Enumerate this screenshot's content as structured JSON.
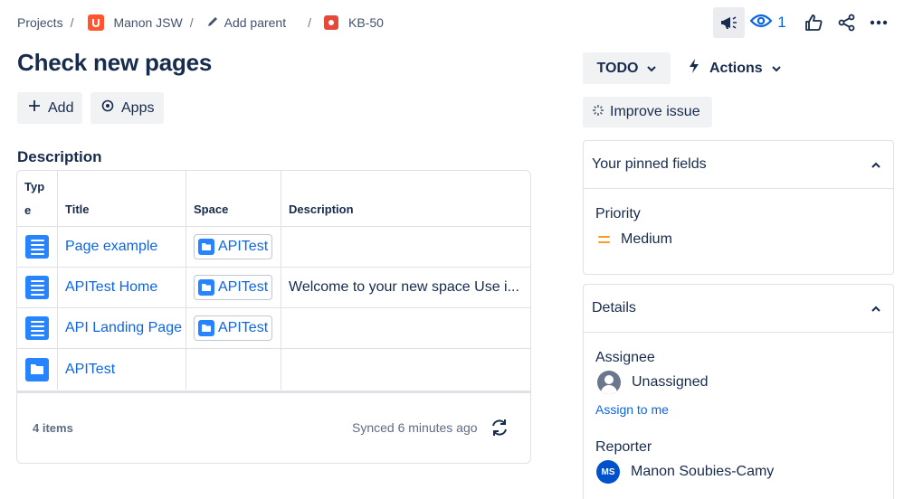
{
  "breadcrumb": {
    "projects": "Projects",
    "separator": "/",
    "project_name": "Manon JSW",
    "add_parent": "Add parent",
    "issue_key": "KB-50"
  },
  "header": {
    "title": "Check new pages",
    "watchers_count": "1"
  },
  "toolbar": {
    "add_label": "Add",
    "apps_label": "Apps"
  },
  "description": {
    "heading": "Description",
    "columns": [
      "Type",
      "Title",
      "Space",
      "Description"
    ],
    "type_header_lines": [
      "Typ",
      "e"
    ],
    "rows": [
      {
        "type_icon": "page-icon",
        "title": "Page example",
        "space": "APITest",
        "description": ""
      },
      {
        "type_icon": "page-icon",
        "title": "APITest Home",
        "space": "APITest",
        "description": "Welcome to your new space Use i..."
      },
      {
        "type_icon": "page-icon",
        "title": "API Landing Page",
        "space": "APITest",
        "description": ""
      },
      {
        "type_icon": "folder-icon",
        "title": "APITest",
        "space": "",
        "description": ""
      }
    ],
    "footer": {
      "items_count": "4 items",
      "synced": "Synced 6 minutes ago"
    }
  },
  "sidebar": {
    "status_label": "TODO",
    "actions_label": "Actions",
    "improve_label": "Improve issue",
    "pinned": {
      "heading": "Your pinned fields",
      "priority_label": "Priority",
      "priority_value": "Medium"
    },
    "details": {
      "heading": "Details",
      "assignee_label": "Assignee",
      "assignee_value": "Unassigned",
      "assign_to_me": "Assign to me",
      "reporter_label": "Reporter",
      "reporter_initials": "MS",
      "reporter_value": "Manon Soubies-Camy"
    }
  },
  "colors": {
    "link": "#0c66e4",
    "text": "#172b4d",
    "button_bg": "#f1f2f4",
    "priority_medium": "#ff991f",
    "confluence_blue": "#2684ff"
  }
}
